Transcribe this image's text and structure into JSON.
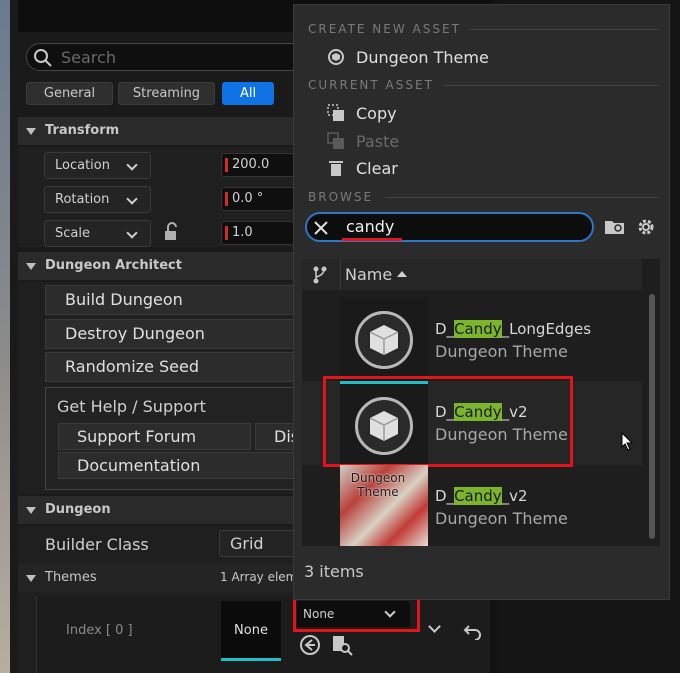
{
  "details": {
    "search_placeholder": "Search",
    "filters": [
      "General",
      "Streaming",
      "All"
    ],
    "transform": {
      "header": "Transform",
      "rows": [
        {
          "label": "Location",
          "value": "200.0"
        },
        {
          "label": "Rotation",
          "value": "0.0 °"
        },
        {
          "label": "Scale",
          "value": "1.0"
        }
      ]
    },
    "dungeon_architect": {
      "header": "Dungeon Architect",
      "buttons": [
        "Build Dungeon",
        "Destroy Dungeon",
        "Randomize Seed"
      ],
      "help_title": "Get Help / Support",
      "help_buttons": [
        "Support Forum",
        "Dis",
        "Documentation"
      ]
    },
    "dungeon": {
      "header": "Dungeon",
      "builder_class_label": "Builder Class",
      "builder_class_value": "Grid",
      "themes_label": "Themes",
      "themes_value": "1 Array elem",
      "index_label": "Index [ 0 ]",
      "thumb_label": "None",
      "select_value": "None"
    }
  },
  "menu": {
    "create_header": "CREATE NEW ASSET",
    "create_item": "Dungeon Theme",
    "current_header": "CURRENT ASSET",
    "copy": "Copy",
    "paste": "Paste",
    "clear": "Clear",
    "browse_header": "BROWSE",
    "filter_value": "candy",
    "column_name": "Name",
    "assets": [
      {
        "prefix": "D_",
        "match": "Candy",
        "suffix": "_LongEdges",
        "type": "Dungeon Theme"
      },
      {
        "prefix": "D_",
        "match": "Candy",
        "suffix": "_v2",
        "type": "Dungeon Theme"
      },
      {
        "prefix": "D_",
        "match": "Candy",
        "suffix": "_v2",
        "type": "Dungeon Theme",
        "thumb_text": "Dungeon Theme"
      }
    ],
    "item_count": "3 items"
  },
  "colors": {
    "accent": "#0f73e6",
    "highlight": "#7bb52b",
    "annotation_red": "#e3141c"
  }
}
